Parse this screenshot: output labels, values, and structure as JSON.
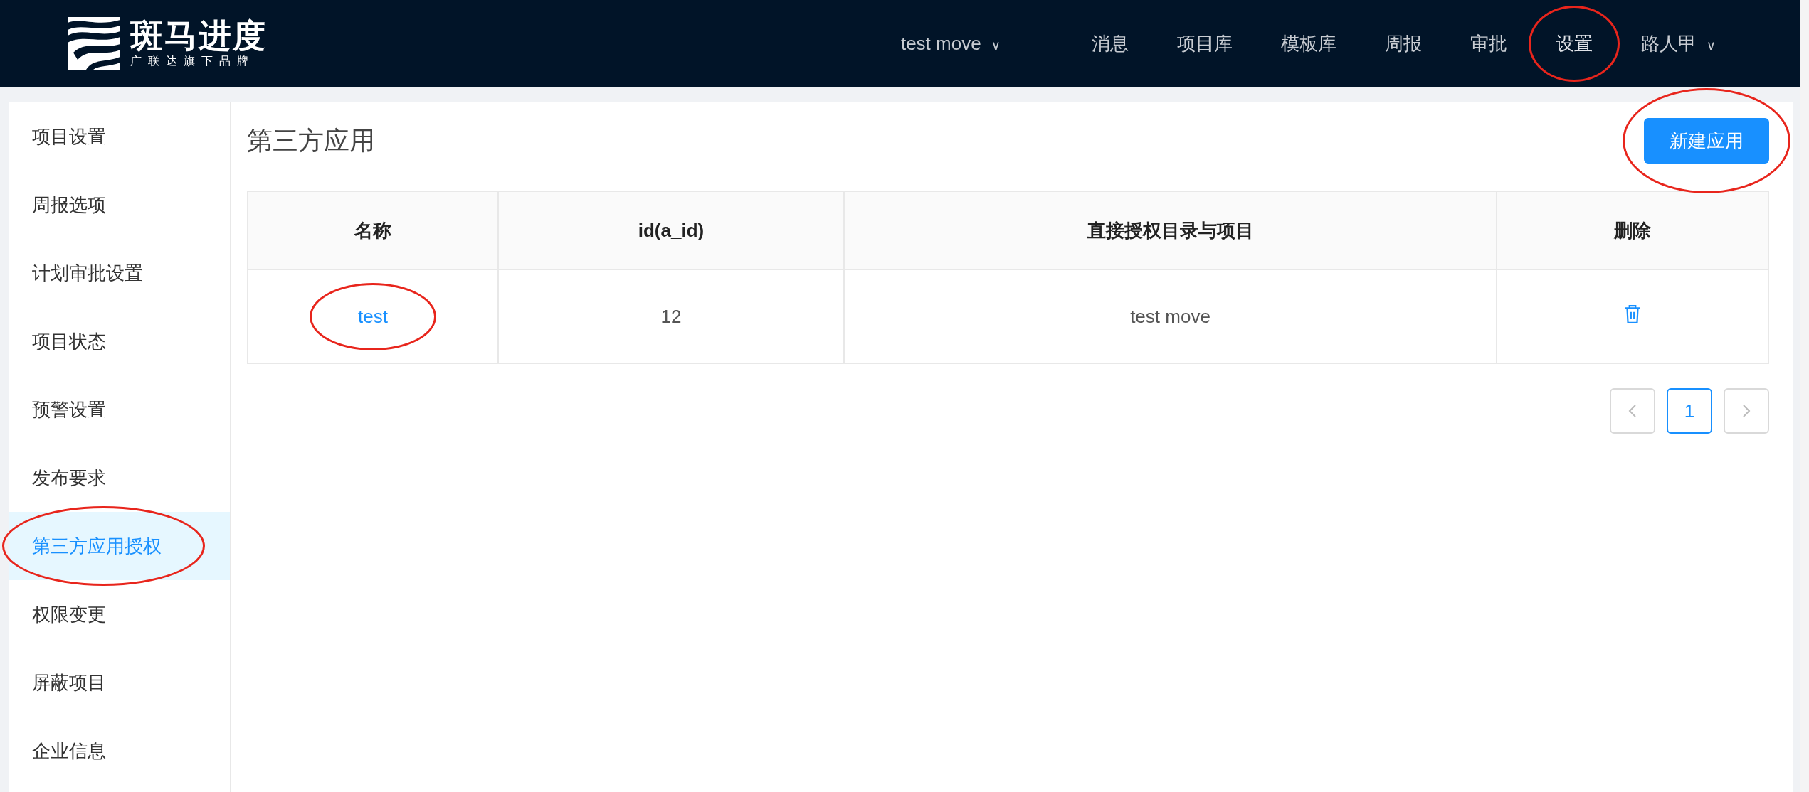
{
  "logo": {
    "name": "斑马进度",
    "tagline": "广联达旗下品牌"
  },
  "nav": {
    "project_switcher": {
      "label": "test move",
      "caret": "∨"
    },
    "items": [
      {
        "label": "消息",
        "selected": false,
        "circled": false
      },
      {
        "label": "项目库",
        "selected": false,
        "circled": false
      },
      {
        "label": "模板库",
        "selected": false,
        "circled": false
      },
      {
        "label": "周报",
        "selected": false,
        "circled": false
      },
      {
        "label": "审批",
        "selected": false,
        "circled": false
      },
      {
        "label": "设置",
        "selected": true,
        "circled": true
      }
    ],
    "user": {
      "label": "路人甲",
      "caret": "∨"
    }
  },
  "sidebar": {
    "items": [
      {
        "label": "项目设置",
        "selected": false,
        "circled": false
      },
      {
        "label": "周报选项",
        "selected": false,
        "circled": false
      },
      {
        "label": "计划审批设置",
        "selected": false,
        "circled": false
      },
      {
        "label": "项目状态",
        "selected": false,
        "circled": false
      },
      {
        "label": "预警设置",
        "selected": false,
        "circled": false
      },
      {
        "label": "发布要求",
        "selected": false,
        "circled": false
      },
      {
        "label": "第三方应用授权",
        "selected": true,
        "circled": true
      },
      {
        "label": "权限变更",
        "selected": false,
        "circled": false
      },
      {
        "label": "屏蔽项目",
        "selected": false,
        "circled": false
      },
      {
        "label": "企业信息",
        "selected": false,
        "circled": false
      }
    ]
  },
  "page": {
    "title": "第三方应用",
    "new_button": {
      "label": "新建应用",
      "circled": true
    }
  },
  "table": {
    "columns": [
      "名称",
      "id(a_id)",
      "直接授权目录与项目",
      "删除"
    ],
    "rows": [
      {
        "name": "test",
        "name_circled": true,
        "id": "12",
        "scope": "test move"
      }
    ]
  },
  "pagination": {
    "pages": [
      {
        "label": "1",
        "selected": true
      }
    ]
  }
}
